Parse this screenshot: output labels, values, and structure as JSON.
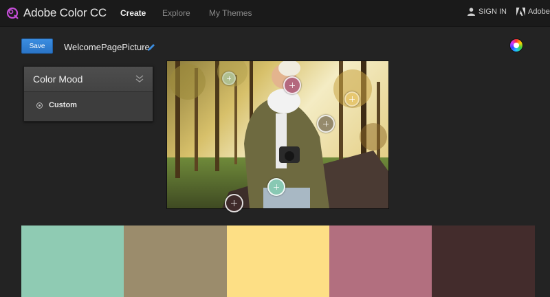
{
  "header": {
    "app_title": "Adobe Color CC",
    "nav": [
      {
        "label": "Create",
        "active": true
      },
      {
        "label": "Explore",
        "active": false
      },
      {
        "label": "My Themes",
        "active": false
      }
    ],
    "signin_label": "SIGN IN",
    "adobe_label": "Adobe"
  },
  "toolbar": {
    "save_label": "Save",
    "theme_name": "WelcomePagePicture"
  },
  "mood_panel": {
    "title": "Color Mood",
    "selected_option": "Custom"
  },
  "photo": {
    "pickers": [
      {
        "color": "#b0bf8f"
      },
      {
        "color": "#b4687e"
      },
      {
        "color": "#e6c770"
      },
      {
        "color": "#958a6c"
      },
      {
        "color": "#88c8b3"
      },
      {
        "color": "#3f2b2b"
      }
    ]
  },
  "swatches": [
    {
      "color": "#8fcbb3"
    },
    {
      "color": "#9b8c6c"
    },
    {
      "color": "#fddf85"
    },
    {
      "color": "#b26f7f"
    },
    {
      "color": "#432c2c"
    }
  ],
  "colors": {
    "accent": "#2a74c6",
    "background": "#232323",
    "topbar": "#1a1a1a"
  }
}
